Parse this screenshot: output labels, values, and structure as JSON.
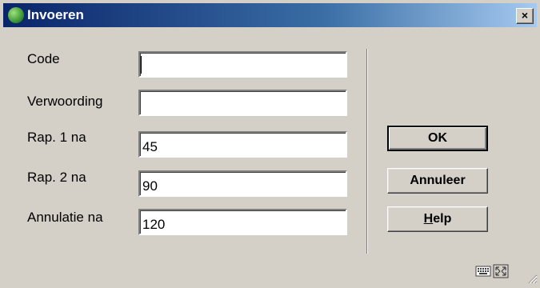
{
  "window": {
    "title": "Invoeren",
    "close_label": "×"
  },
  "form": {
    "fields": [
      {
        "label": "Code",
        "value": ""
      },
      {
        "label": "Verwoording",
        "value": ""
      },
      {
        "label": "Rap. 1 na",
        "value": "45"
      },
      {
        "label": "Rap. 2 na",
        "value": "90"
      },
      {
        "label": "Annulatie na",
        "value": "120"
      }
    ]
  },
  "buttons": {
    "ok": "OK",
    "cancel": "Annuleer",
    "help_mnemonic": "H",
    "help_rest": "elp"
  },
  "status_icons": [
    "keyboard-icon",
    "expand-icon",
    "resize-grip-icon"
  ]
}
